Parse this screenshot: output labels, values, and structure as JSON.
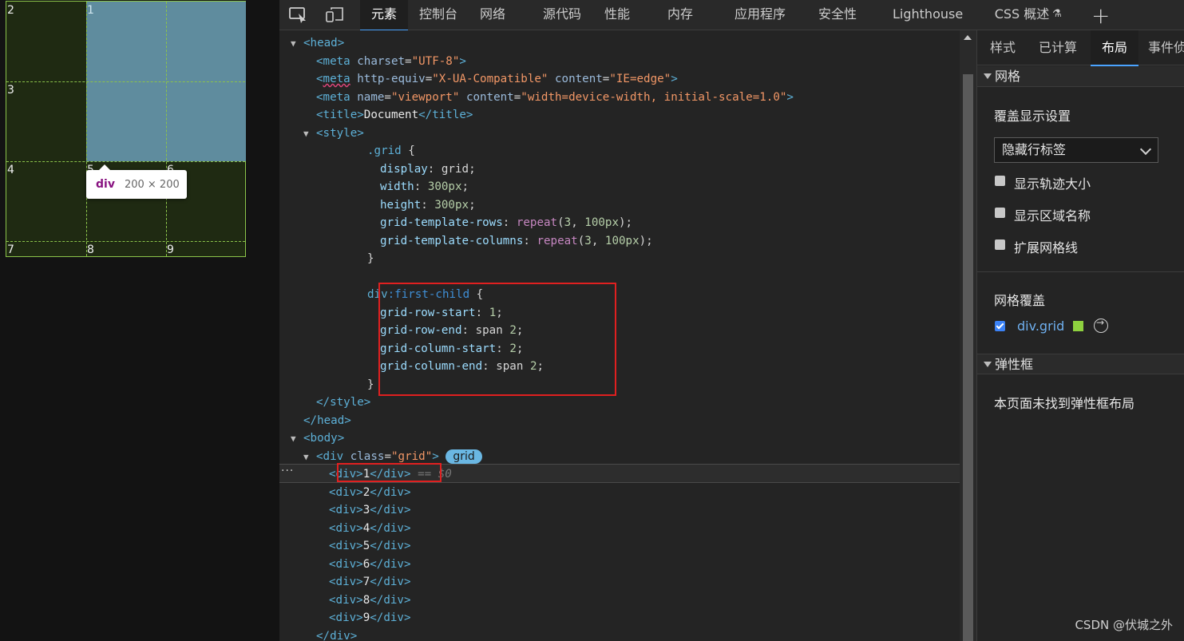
{
  "preview": {
    "grid_numbers": [
      "2",
      "1",
      "3",
      "4",
      "5",
      "6",
      "7",
      "8",
      "9"
    ],
    "tooltip_tag": "div",
    "tooltip_size": "200 × 200"
  },
  "toolbar": {
    "tabs": [
      "元素",
      "控制台",
      "网络",
      "源代码",
      "性能",
      "内存",
      "应用程序",
      "安全性",
      "Lighthouse",
      "CSS 概述"
    ],
    "active_tab": "元素"
  },
  "dom": {
    "lines": [
      {
        "indent": 2,
        "tri": "▼",
        "html": "<span class='t'>&lt;head&gt;</span>"
      },
      {
        "indent": 3,
        "tri": "",
        "html": "<span class='t'>&lt;meta </span><span class='a'>charset</span>=<span class='v'>\"UTF-8\"</span><span class='t'>&gt;</span>"
      },
      {
        "indent": 3,
        "tri": "",
        "html": "<span class='t'>&lt;<span class='squiggle'>meta</span> </span><span class='a'>http-equiv</span>=<span class='v'>\"X-UA-Compatible\"</span> <span class='a'>content</span>=<span class='v'>\"IE=edge\"</span><span class='t'>&gt;</span>"
      },
      {
        "indent": 3,
        "tri": "",
        "html": "<span class='t'>&lt;meta </span><span class='a'>name</span>=<span class='v'>\"viewport\"</span> <span class='a'>content</span>=<span class='v'>\"width=device-width, initial-scale=1.0\"</span><span class='t'>&gt;</span>"
      },
      {
        "indent": 3,
        "tri": "",
        "html": "<span class='t'>&lt;title&gt;</span><span class='txt'>Document</span><span class='t'>&lt;/title&gt;</span>"
      },
      {
        "indent": 3,
        "tri": "▼",
        "html": "<span class='t'>&lt;style&gt;</span>"
      },
      {
        "indent": 7,
        "tri": "",
        "html": "<span class='sel'>.grid</span> {"
      },
      {
        "indent": 8,
        "tri": "",
        "html": "<span class='p'>display</span>: <span class='val'>grid</span>;"
      },
      {
        "indent": 8,
        "tri": "",
        "html": "<span class='p'>width</span>: <span class='n'>300px</span>;"
      },
      {
        "indent": 8,
        "tri": "",
        "html": "<span class='p'>height</span>: <span class='n'>300px</span>;"
      },
      {
        "indent": 8,
        "tri": "",
        "html": "<span class='p'>grid-template-rows</span>: <span class='kw'>repeat</span>(<span class='n'>3</span>, <span class='n'>100px</span>);"
      },
      {
        "indent": 8,
        "tri": "",
        "html": "<span class='p'>grid-template-columns</span>: <span class='kw'>repeat</span>(<span class='n'>3</span>, <span class='n'>100px</span>);"
      },
      {
        "indent": 7,
        "tri": "",
        "html": "}"
      },
      {
        "indent": 7,
        "tri": "",
        "html": ""
      },
      {
        "indent": 7,
        "tri": "",
        "html": "<span class='sel'>div</span><span class='pcls'>:first-child</span> {"
      },
      {
        "indent": 8,
        "tri": "",
        "html": "<span class='p'>grid-row-start</span>: <span class='n'>1</span>;"
      },
      {
        "indent": 8,
        "tri": "",
        "html": "<span class='p'>grid-row-end</span>: <span class='val'>span</span> <span class='n'>2</span>;"
      },
      {
        "indent": 8,
        "tri": "",
        "html": "<span class='p'>grid-column-start</span>: <span class='n'>2</span>;"
      },
      {
        "indent": 8,
        "tri": "",
        "html": "<span class='p'>grid-column-end</span>: <span class='val'>span</span> <span class='n'>2</span>;"
      },
      {
        "indent": 7,
        "tri": "",
        "html": "}"
      },
      {
        "indent": 3,
        "tri": "",
        "html": "<span class='t'>&lt;/style&gt;</span>"
      },
      {
        "indent": 2,
        "tri": "",
        "html": "<span class='t'>&lt;/head&gt;</span>"
      },
      {
        "indent": 2,
        "tri": "▼",
        "html": "<span class='t'>&lt;body&gt;</span>"
      },
      {
        "indent": 3,
        "tri": "▼",
        "html": "<span class='t'>&lt;div </span><span class='a'>class</span>=<span class='v'>\"grid\"</span><span class='t'>&gt;</span> <span id='grid-badge' data-name='grid-badge' data-interactable='true'>grid</span>"
      },
      {
        "indent": 4,
        "tri": "",
        "html": "<span class='t'>&lt;div&gt;</span><span class='txt'>1</span><span class='t'>&lt;/div&gt;</span> <span class='dollar'>== $0</span>"
      },
      {
        "indent": 4,
        "tri": "",
        "html": "<span class='t'>&lt;div&gt;</span><span class='txt'>2</span><span class='t'>&lt;/div&gt;</span>"
      },
      {
        "indent": 4,
        "tri": "",
        "html": "<span class='t'>&lt;div&gt;</span><span class='txt'>3</span><span class='t'>&lt;/div&gt;</span>"
      },
      {
        "indent": 4,
        "tri": "",
        "html": "<span class='t'>&lt;div&gt;</span><span class='txt'>4</span><span class='t'>&lt;/div&gt;</span>"
      },
      {
        "indent": 4,
        "tri": "",
        "html": "<span class='t'>&lt;div&gt;</span><span class='txt'>5</span><span class='t'>&lt;/div&gt;</span>"
      },
      {
        "indent": 4,
        "tri": "",
        "html": "<span class='t'>&lt;div&gt;</span><span class='txt'>6</span><span class='t'>&lt;/div&gt;</span>"
      },
      {
        "indent": 4,
        "tri": "",
        "html": "<span class='t'>&lt;div&gt;</span><span class='txt'>7</span><span class='t'>&lt;/div&gt;</span>"
      },
      {
        "indent": 4,
        "tri": "",
        "html": "<span class='t'>&lt;div&gt;</span><span class='txt'>8</span><span class='t'>&lt;/div&gt;</span>"
      },
      {
        "indent": 4,
        "tri": "",
        "html": "<span class='t'>&lt;div&gt;</span><span class='txt'>9</span><span class='t'>&lt;/div&gt;</span>"
      },
      {
        "indent": 3,
        "tri": "",
        "html": "<span class='t'>&lt;/div&gt;</span>"
      }
    ],
    "ellipsis": "···"
  },
  "sidebar": {
    "tabs": [
      "样式",
      "已计算",
      "布局",
      "事件侦"
    ],
    "active_tab": "布局",
    "grid_section": "网格",
    "overlay_settings": "覆盖显示设置",
    "overlay_select_value": "隐藏行标签",
    "checkboxes": [
      "显示轨迹大小",
      "显示区域名称",
      "扩展网格线"
    ],
    "grid_overlays": "网格覆盖",
    "grid_item": "div.grid",
    "swatch_color": "#8ed13f",
    "flex_section": "弹性框",
    "flex_empty": "本页面未找到弹性框布局"
  },
  "watermark": "CSDN @伏城之外"
}
